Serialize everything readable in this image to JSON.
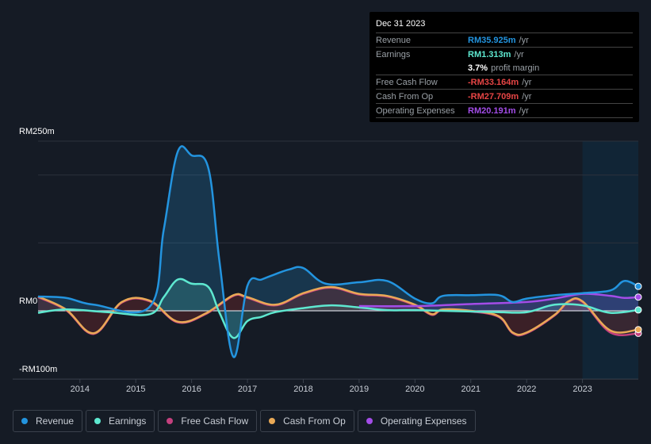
{
  "tooltip": {
    "date": "Dec 31 2023",
    "rows": [
      {
        "label": "Revenue",
        "value": "RM35.925m",
        "unit": "/yr",
        "color": "#2394df"
      },
      {
        "label": "Earnings",
        "value": "RM1.313m",
        "unit": "/yr",
        "color": "#5ee8d0"
      },
      {
        "label": "",
        "value": "3.7%",
        "unit": "profit margin",
        "color": "#ffffff"
      },
      {
        "label": "Free Cash Flow",
        "value": "-RM33.164m",
        "unit": "/yr",
        "color": "#e64545"
      },
      {
        "label": "Cash From Op",
        "value": "-RM27.709m",
        "unit": "/yr",
        "color": "#e64545"
      },
      {
        "label": "Operating Expenses",
        "value": "RM20.191m",
        "unit": "/yr",
        "color": "#a34de8"
      }
    ]
  },
  "chart_data": {
    "type": "line",
    "ylim": [
      -100,
      250
    ],
    "xlim": [
      2013.25,
      2024.0
    ],
    "y_tick_labels": [
      "RM250m",
      "RM0",
      "-RM100m"
    ],
    "y_ticks": [
      250,
      0,
      -100
    ],
    "x_tick_labels": [
      "2014",
      "2015",
      "2016",
      "2017",
      "2018",
      "2019",
      "2020",
      "2021",
      "2022",
      "2023"
    ],
    "grid": true,
    "forecast_shading_from": 2023.0,
    "legend_placement": "bottom",
    "series": [
      {
        "name": "Revenue",
        "color": "#2394df",
        "x": [
          2013.25,
          2013.75,
          2014.25,
          2015.25,
          2015.5,
          2015.75,
          2016.0,
          2016.3,
          2016.5,
          2016.75,
          2017.0,
          2017.25,
          2017.5,
          2017.75,
          2018.0,
          2018.4,
          2019.0,
          2019.5,
          2020.0,
          2020.3,
          2020.5,
          2021.0,
          2021.5,
          2021.75,
          2022.0,
          2022.5,
          2023.0,
          2023.5,
          2023.75,
          2024.0
        ],
        "y": [
          21,
          19,
          9,
          6,
          119,
          234,
          229,
          210,
          72,
          -68,
          37,
          46,
          54,
          61,
          63,
          40,
          42,
          44,
          18,
          11,
          22,
          23,
          23,
          13,
          18,
          23,
          26,
          30,
          44,
          36
        ]
      },
      {
        "name": "Earnings",
        "color": "#5ee8d0",
        "x": [
          2013.25,
          2013.75,
          2014.5,
          2015.25,
          2015.5,
          2015.75,
          2016.0,
          2016.3,
          2016.5,
          2016.75,
          2017.0,
          2017.25,
          2017.5,
          2018.0,
          2018.5,
          2019.0,
          2019.5,
          2020.0,
          2021.0,
          2021.5,
          2022.0,
          2022.5,
          2023.0,
          2023.5,
          2024.0
        ],
        "y": [
          -3,
          2,
          -2,
          -5,
          20,
          46,
          40,
          35,
          -3,
          -40,
          -15,
          -9,
          -2,
          4,
          8,
          5,
          1,
          1,
          -1,
          -2,
          -2,
          9,
          8,
          -3,
          1.3
        ]
      },
      {
        "name": "Free Cash Flow",
        "color": "#c4407e",
        "x": [
          2013.25,
          2013.75,
          2014.25,
          2014.75,
          2015.25,
          2015.75,
          2016.25,
          2016.75,
          2017.0,
          2017.5,
          2018.0,
          2018.5,
          2019.0,
          2019.5,
          2020.0,
          2020.3,
          2020.5,
          2021.0,
          2021.5,
          2021.75,
          2022.0,
          2022.5,
          2022.75,
          2023.0,
          2023.5,
          2024.0
        ],
        "y": [
          20,
          1,
          -34,
          12,
          14,
          -17,
          -5,
          22,
          19,
          8,
          25,
          34,
          24,
          21,
          8,
          -6,
          1,
          -1,
          -9,
          -33,
          -33,
          -7,
          13,
          13,
          -32,
          -33.2
        ]
      },
      {
        "name": "Cash From Op",
        "color": "#e9a956",
        "x": [
          2013.25,
          2013.75,
          2014.25,
          2014.75,
          2015.25,
          2015.75,
          2016.25,
          2016.75,
          2017.0,
          2017.5,
          2018.0,
          2018.5,
          2019.0,
          2019.5,
          2020.0,
          2020.3,
          2020.5,
          2021.0,
          2021.5,
          2021.75,
          2022.0,
          2022.5,
          2022.75,
          2023.0,
          2023.5,
          2024.0
        ],
        "y": [
          21,
          2,
          -33,
          13,
          15,
          -16,
          -4,
          23,
          20,
          9,
          26,
          35,
          25,
          22,
          9,
          -5,
          2,
          0,
          -8,
          -32,
          -32,
          -6,
          14,
          14,
          -29,
          -27.7
        ]
      },
      {
        "name": "Operating Expenses",
        "color": "#a34de8",
        "x": [
          2019.0,
          2020.0,
          2021.0,
          2022.0,
          2022.5,
          2023.0,
          2023.5,
          2023.75,
          2024.0
        ],
        "y": [
          7,
          7,
          10,
          13,
          18,
          25,
          22,
          19,
          20.2
        ]
      }
    ]
  },
  "legend": [
    {
      "label": "Revenue",
      "color": "#2394df"
    },
    {
      "label": "Earnings",
      "color": "#5ee8d0"
    },
    {
      "label": "Free Cash Flow",
      "color": "#c4407e"
    },
    {
      "label": "Cash From Op",
      "color": "#e9a956"
    },
    {
      "label": "Operating Expenses",
      "color": "#a34de8"
    }
  ]
}
